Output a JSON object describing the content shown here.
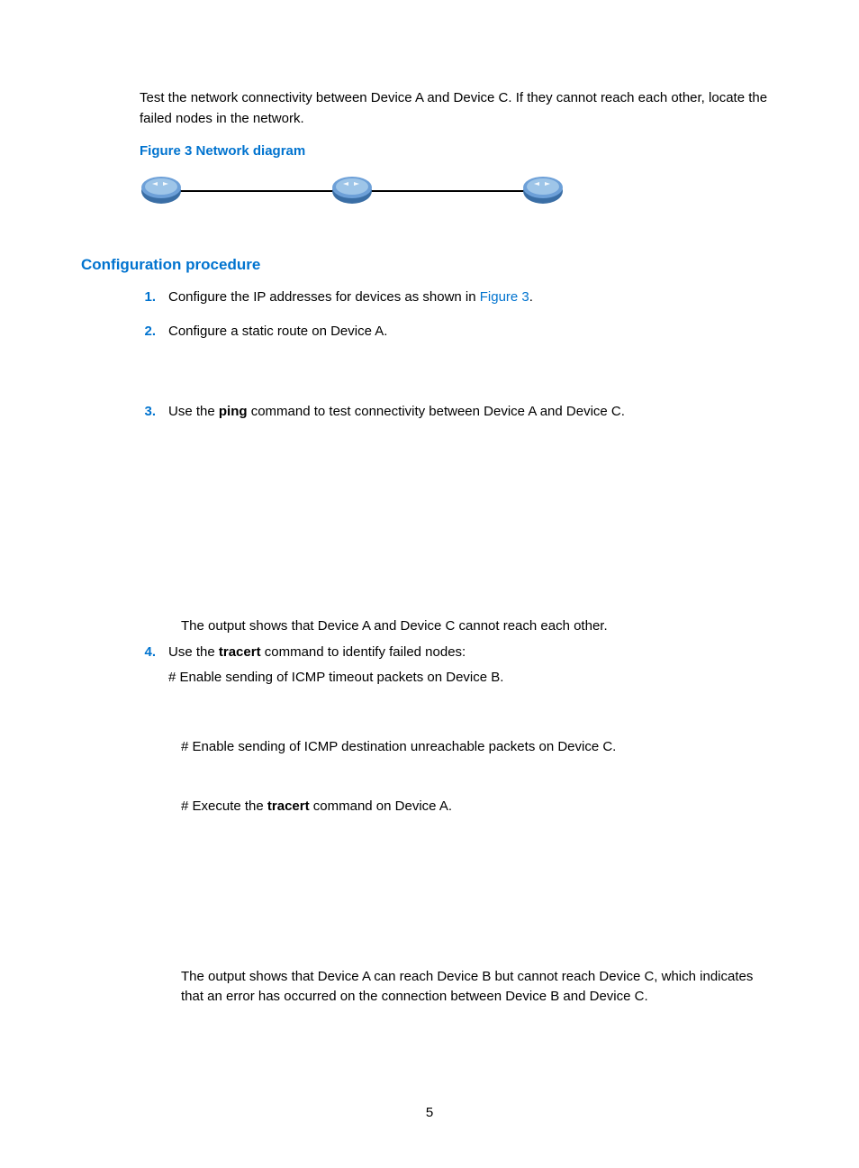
{
  "intro": "Test the network connectivity between Device A and Device C. If they cannot reach each other, locate the failed nodes in the network.",
  "figure_caption": "Figure 3 Network diagram",
  "section_heading": "Configuration procedure",
  "steps": {
    "n1": "1.",
    "s1a": "Configure the IP addresses for devices as shown in ",
    "s1b": "Figure 3",
    "s1c": ".",
    "n2": "2.",
    "s2": "Configure a static route on Device A.",
    "n3": "3.",
    "s3a": "Use the ",
    "s3b": "ping",
    "s3c": " command to test connectivity between Device A and Device C.",
    "s3_out": "The output shows that Device A and Device C cannot reach each other.",
    "n4": "4.",
    "s4a": "Use the ",
    "s4b": "tracert",
    "s4c": " command to identify failed nodes:",
    "s4d": "# Enable sending of ICMP timeout packets on Device B.",
    "s4e": "# Enable sending of ICMP destination unreachable packets on Device C.",
    "s4f_a": "# Execute the ",
    "s4f_b": "tracert",
    "s4f_c": " command on Device A.",
    "s4_out": "The output shows that Device A can reach Device B but cannot reach Device C, which indicates that an error has occurred on the connection between Device B and Device C."
  },
  "page_number": "5"
}
